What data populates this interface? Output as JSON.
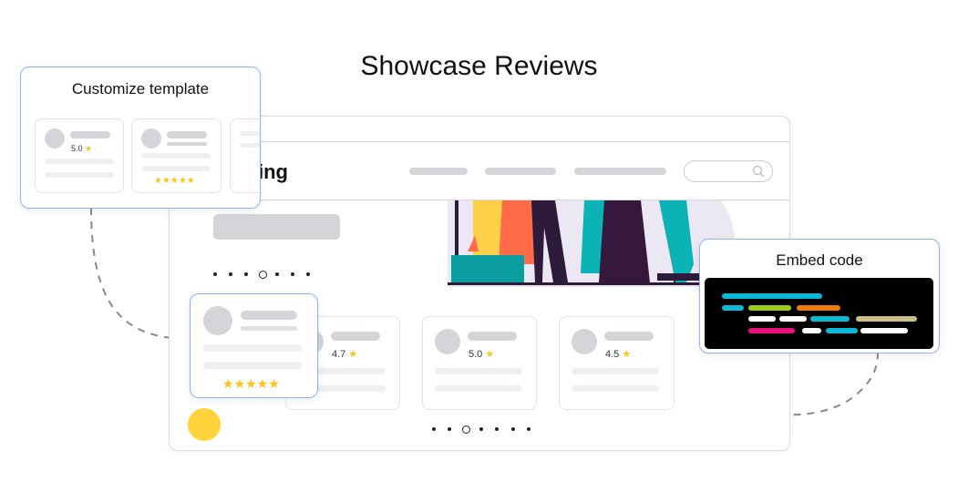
{
  "title": "Showcase Reviews",
  "browser": {
    "logo_text": "ing",
    "search_icon": "search-icon",
    "hero_dots": {
      "count": 7,
      "active": 4
    },
    "review_dots": {
      "count": 7,
      "active": 3
    }
  },
  "reviews": [
    {
      "rating": "4.7"
    },
    {
      "rating": "5.0"
    },
    {
      "rating": "4.5"
    }
  ],
  "star_glyph": "★",
  "five_stars": "★★★★★",
  "customize": {
    "title": "Customize template",
    "mini_rating": "5.0"
  },
  "embed": {
    "title": "Embed code"
  },
  "colors": {
    "accent_border": "#8fb1f5",
    "star": "#f7c51e",
    "yellow_dot": "#ffd43b",
    "code_cyan": "#0bb8d6",
    "code_green": "#9ccc1a",
    "code_orange": "#ef7d0d",
    "code_tan": "#cbbf83",
    "code_pink": "#e8127a"
  }
}
